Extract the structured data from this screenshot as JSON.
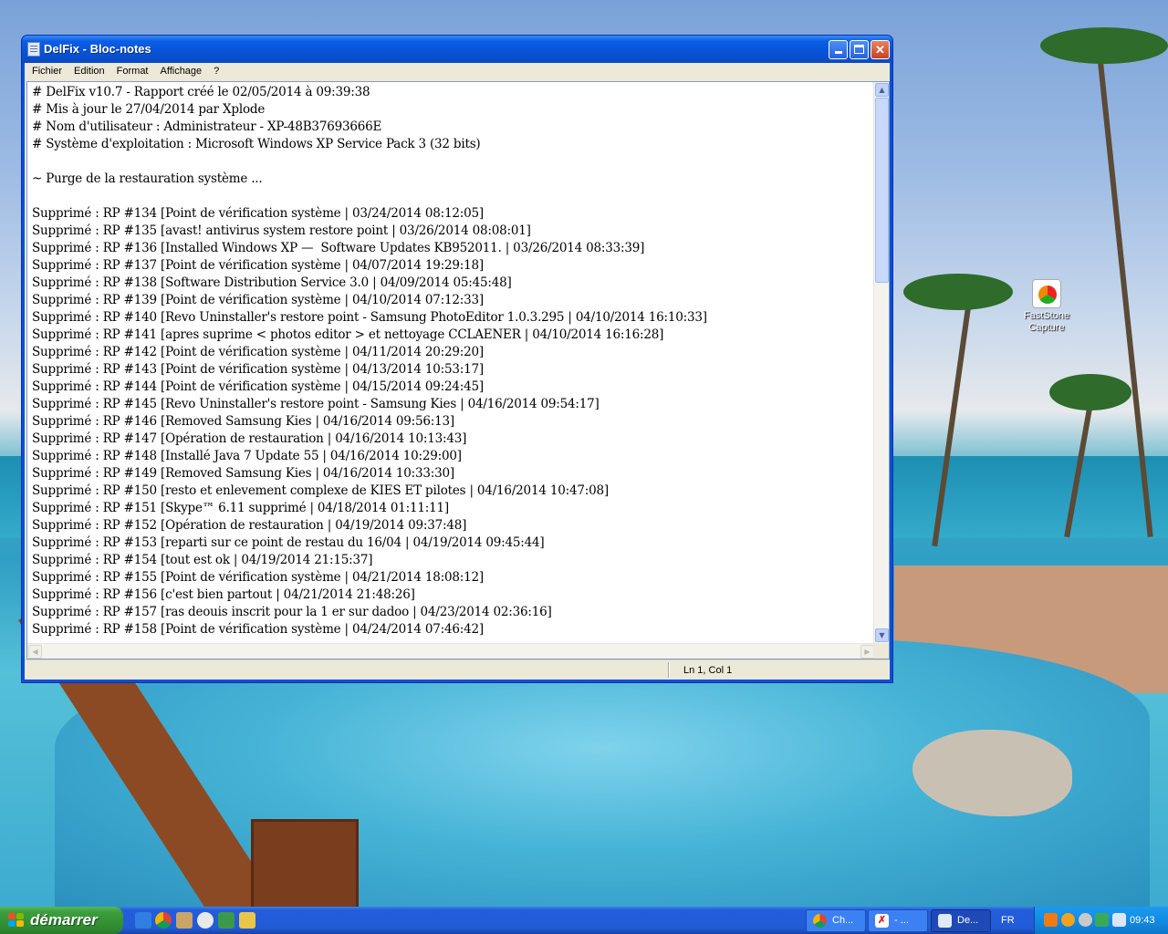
{
  "desktop": {
    "icons": [
      {
        "label_line1": "FastStone",
        "label_line2": "Capture"
      }
    ]
  },
  "window": {
    "title": "DelFix - Bloc-notes",
    "menu": [
      "Fichier",
      "Edition",
      "Format",
      "Affichage",
      "?"
    ],
    "status_position": "Ln 1, Col 1",
    "lines": [
      "# DelFix v10.7 - Rapport créé le 02/05/2014 à 09:39:38",
      "# Mis à jour le 27/04/2014 par Xplode",
      "# Nom d'utilisateur : Administrateur - XP-48B37693666E",
      "# Système d'exploitation : Microsoft Windows XP Service Pack 3 (32 bits)",
      "",
      "~ Purge de la restauration système ...",
      "",
      "Supprimé : RP #134 [Point de vérification système | 03/24/2014 08:12:05]",
      "Supprimé : RP #135 [avast! antivirus system restore point | 03/26/2014 08:08:01]",
      "Supprimé : RP #136 [Installed Windows XP —  Software Updates KB952011. | 03/26/2014 08:33:39]",
      "Supprimé : RP #137 [Point de vérification système | 04/07/2014 19:29:18]",
      "Supprimé : RP #138 [Software Distribution Service 3.0 | 04/09/2014 05:45:48]",
      "Supprimé : RP #139 [Point de vérification système | 04/10/2014 07:12:33]",
      "Supprimé : RP #140 [Revo Uninstaller's restore point - Samsung PhotoEditor 1.0.3.295 | 04/10/2014 16:10:33]",
      "Supprimé : RP #141 [apres suprime < photos editor > et nettoyage CCLAENER | 04/10/2014 16:16:28]",
      "Supprimé : RP #142 [Point de vérification système | 04/11/2014 20:29:20]",
      "Supprimé : RP #143 [Point de vérification système | 04/13/2014 10:53:17]",
      "Supprimé : RP #144 [Point de vérification système | 04/15/2014 09:24:45]",
      "Supprimé : RP #145 [Revo Uninstaller's restore point - Samsung Kies | 04/16/2014 09:54:17]",
      "Supprimé : RP #146 [Removed Samsung Kies | 04/16/2014 09:56:13]",
      "Supprimé : RP #147 [Opération de restauration | 04/16/2014 10:13:43]",
      "Supprimé : RP #148 [Installé Java 7 Update 55 | 04/16/2014 10:29:00]",
      "Supprimé : RP #149 [Removed Samsung Kies | 04/16/2014 10:33:30]",
      "Supprimé : RP #150 [resto et enlevement complexe de KIES ET pilotes | 04/16/2014 10:47:08]",
      "Supprimé : RP #151 [Skype™ 6.11 supprimé | 04/18/2014 01:11:11]",
      "Supprimé : RP #152 [Opération de restauration | 04/19/2014 09:37:48]",
      "Supprimé : RP #153 [reparti sur ce point de restau du 16/04 | 04/19/2014 09:45:44]",
      "Supprimé : RP #154 [tout est ok | 04/19/2014 21:15:37]",
      "Supprimé : RP #155 [Point de vérification système | 04/21/2014 18:08:12]",
      "Supprimé : RP #156 [c'est bien partout | 04/21/2014 21:48:26]",
      "Supprimé : RP #157 [ras deouis inscrit pour la 1 er sur dadoo | 04/23/2014 02:36:16]",
      "Supprimé : RP #158 [Point de vérification système | 04/24/2014 07:46:42]"
    ]
  },
  "taskbar": {
    "start_label": "démarrer",
    "tasks": [
      {
        "label": "Ch...",
        "icon": "chrome-icon"
      },
      {
        "label": "- ...",
        "icon": "delfix-icon"
      },
      {
        "label": "De...",
        "icon": "notepad-icon"
      }
    ],
    "language": "FR",
    "clock": "09:43"
  }
}
